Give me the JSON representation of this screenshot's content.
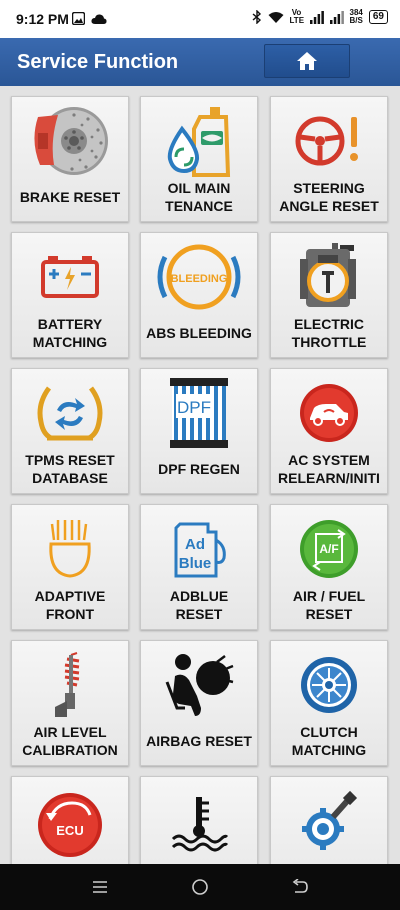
{
  "status_bar": {
    "time": "9:12 PM",
    "net_speed_value": "384",
    "net_speed_unit": "B/S",
    "lte_label": "Vo LTE",
    "battery": "69"
  },
  "header": {
    "title": "Service Function",
    "home_icon": "home-icon"
  },
  "tiles": [
    {
      "label": "BRAKE RESET",
      "icon": "brake-disc-icon"
    },
    {
      "label": "OIL MAIN\nTENANCE",
      "icon": "oil-can-icon"
    },
    {
      "label": "STEERING\nANGLE RESET",
      "icon": "steering-warning-icon"
    },
    {
      "label": "BATTERY\nMATCHING",
      "icon": "battery-icon"
    },
    {
      "label": "ABS BLEEDING",
      "icon": "abs-bleeding-icon",
      "icon_text": "BLEEDING"
    },
    {
      "label": "ELECTRIC\nTHROTTLE",
      "icon": "throttle-body-icon"
    },
    {
      "label": "TPMS RESET\nDATABASE",
      "icon": "tpms-icon"
    },
    {
      "label": "DPF REGEN",
      "icon": "dpf-filter-icon",
      "icon_text": "DPF"
    },
    {
      "label": "AC SYSTEM\nRELEARN/INITI",
      "icon": "ac-system-icon"
    },
    {
      "label": "ADAPTIVE\nFRONT",
      "icon": "headlight-icon"
    },
    {
      "label": "ADBLUE\nRESET",
      "icon": "adblue-icon",
      "icon_text_1": "Ad",
      "icon_text_2": "Blue"
    },
    {
      "label": "AIR / FUEL\nRESET",
      "icon": "air-fuel-icon",
      "icon_text": "A/F"
    },
    {
      "label": "AIR LEVEL\nCALIBRATION",
      "icon": "suspension-icon"
    },
    {
      "label": "AIRBAG RESET",
      "icon": "airbag-icon"
    },
    {
      "label": "CLUTCH\nMATCHING",
      "icon": "clutch-icon"
    },
    {
      "label": "",
      "icon": "ecu-reset-icon",
      "icon_text": "ECU"
    },
    {
      "label": "",
      "icon": "coolant-temp-icon"
    },
    {
      "label": "",
      "icon": "gear-sensor-icon"
    }
  ],
  "nav_bar": {
    "menu_icon": "menu-icon",
    "home_icon": "circle-home-icon",
    "back_icon": "back-icon"
  }
}
